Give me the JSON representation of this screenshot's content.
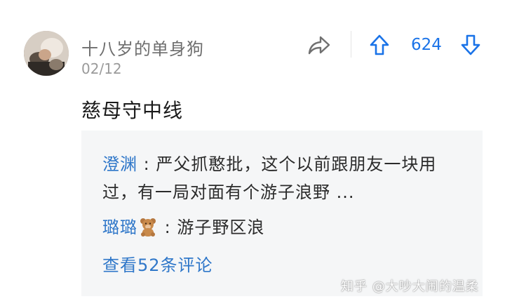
{
  "comment": {
    "username": "十八岁的单身狗",
    "date": "02/12",
    "vote_count": "624",
    "text": "慈母守中线"
  },
  "replies": [
    {
      "name": "澄渊",
      "separator": " : ",
      "text": "严父抓憨批，这个以前跟朋友一块用过，有一局对面有个游子浪野 ..."
    },
    {
      "name": "璐璐",
      "emoji": "bear-icon",
      "separator": " : ",
      "text": "游子野区浪"
    }
  ],
  "more_replies_label": "查看52条评论",
  "watermark": "知乎 @大吵大闹的温柔",
  "colors": {
    "accent": "#1a73e8",
    "link": "#2f77c9",
    "reply_bg": "#f5f6f7"
  }
}
